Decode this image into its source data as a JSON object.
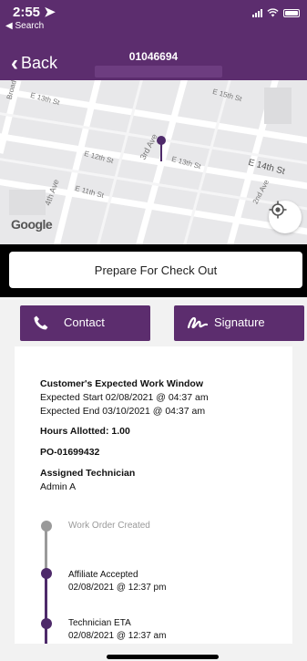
{
  "status_bar": {
    "time": "2:55 ➤",
    "back_app": "◀ Search"
  },
  "nav": {
    "back_label": "Back",
    "title": "01046694"
  },
  "map": {
    "attribution": "Google",
    "streets": [
      "Broad",
      "E 13th St",
      "E 15th St",
      "E 12th St",
      "3rd Ave",
      "E 13th St",
      "E 14th St",
      "4th Ave",
      "E 11th St",
      "2nd Ave"
    ]
  },
  "actions": {
    "prepare_checkout": "Prepare For Check Out",
    "contact": "Contact",
    "signature": "Signature"
  },
  "work_window": {
    "heading": "Customer's Expected Work Window",
    "start": "Expected Start 02/08/2021 @ 04:37 am",
    "end": "Expected End 03/10/2021 @ 04:37 am"
  },
  "hours_allotted": "Hours Allotted: 1.00",
  "po_number": "PO-01699432",
  "technician": {
    "heading": "Assigned Technician",
    "name": "Admin A"
  },
  "timeline": [
    {
      "label": "Work Order Created",
      "time": "",
      "state": "pending"
    },
    {
      "label": "Affiliate Accepted",
      "time": "02/08/2021 @ 12:37 pm",
      "state": "done"
    },
    {
      "label": "Technician ETA",
      "time": "02/08/2021 @ 12:37 am",
      "state": "done"
    }
  ],
  "colors": {
    "brand_purple": "#5c2d6e",
    "timeline_purple": "#4e2a6a",
    "timeline_gray": "#9a9a9a"
  }
}
